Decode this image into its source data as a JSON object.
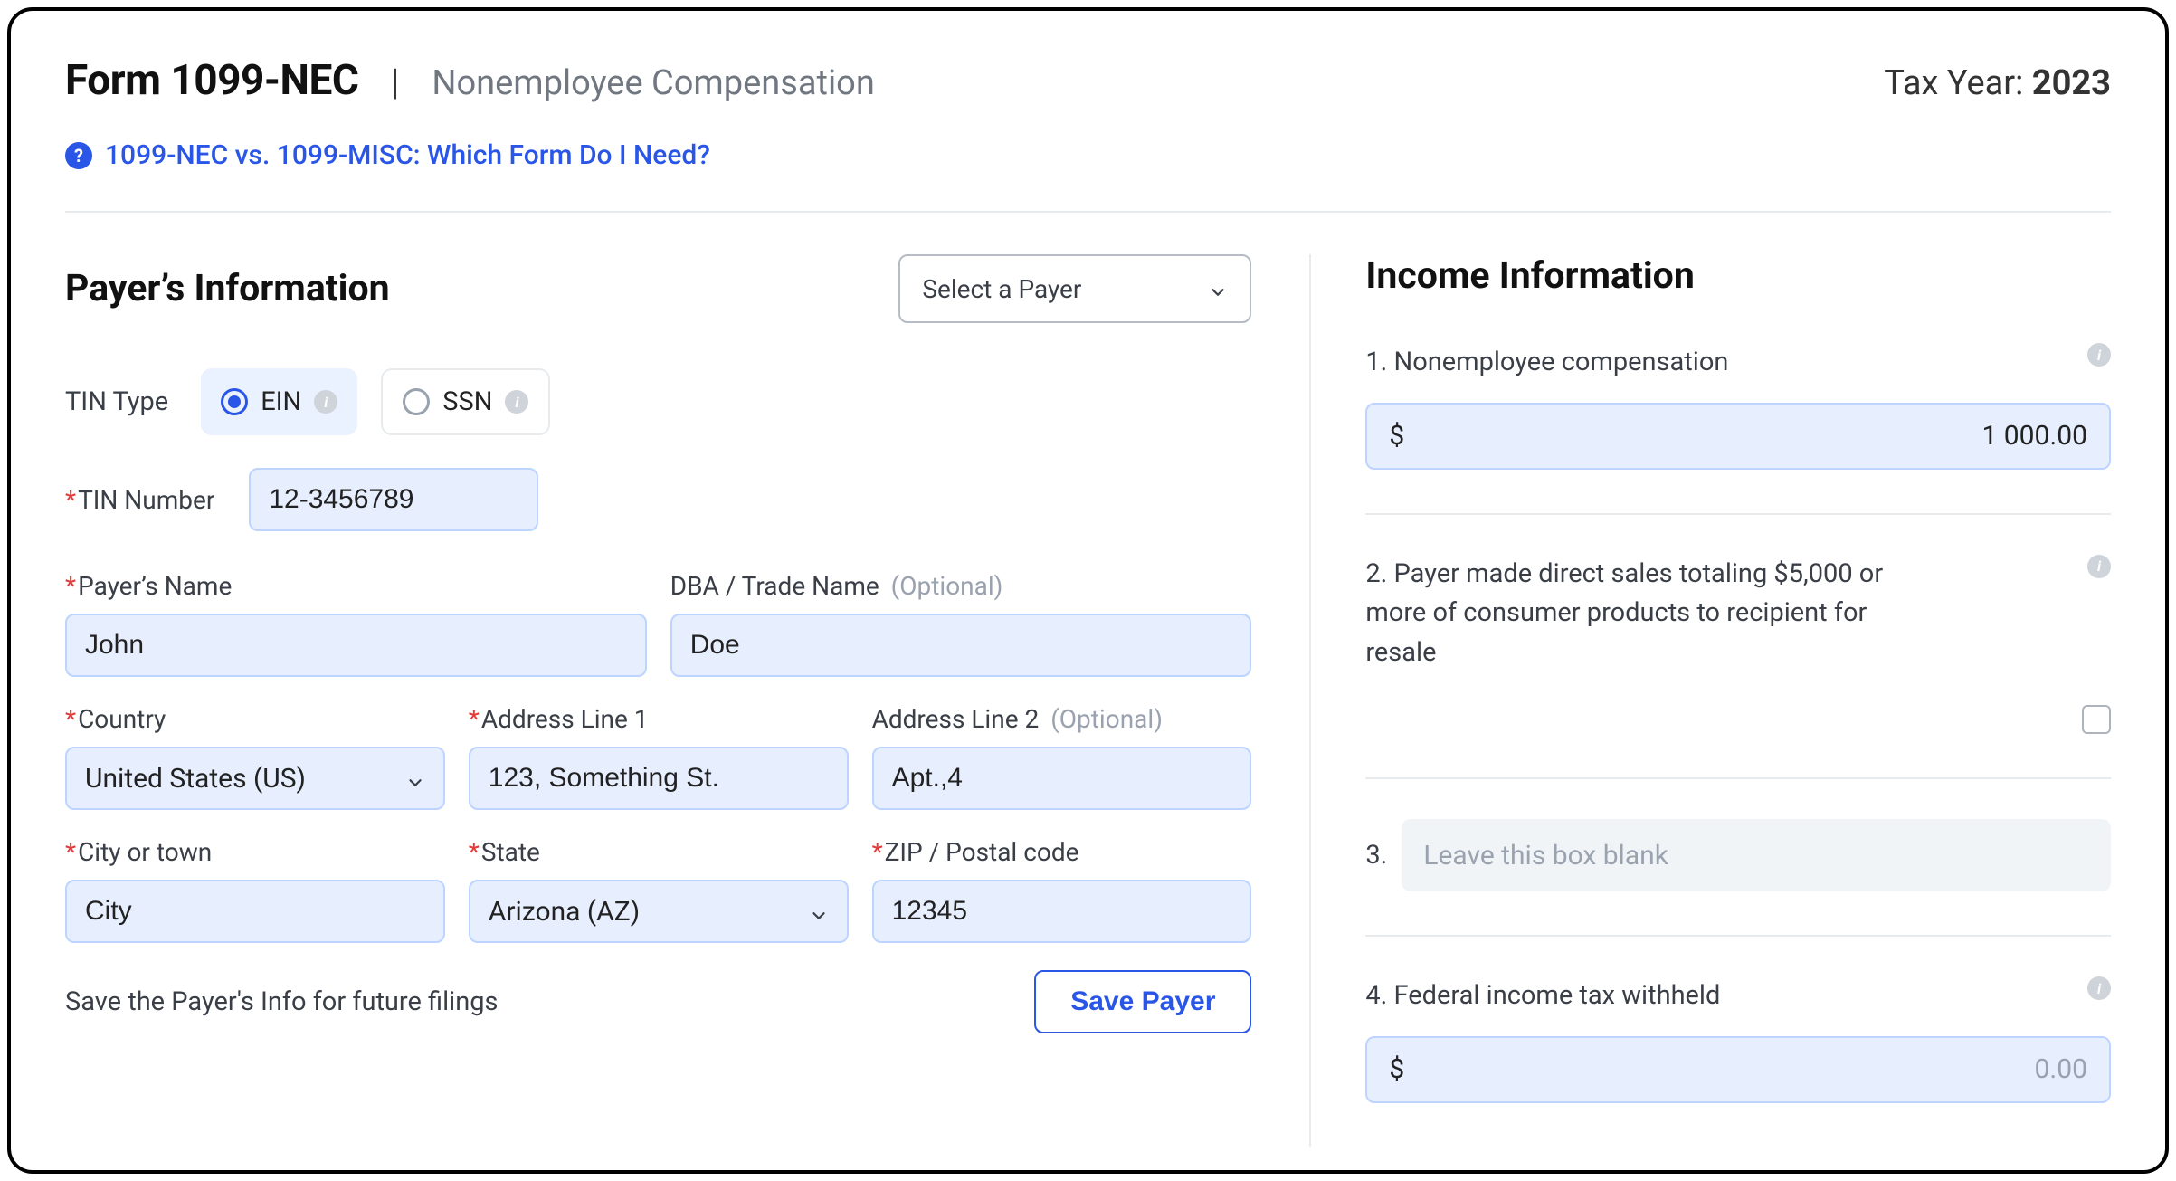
{
  "header": {
    "form_title": "Form 1099-NEC",
    "form_subtitle": "Nonemployee Compensation",
    "tax_year_label": "Tax Year:",
    "tax_year_value": "2023",
    "help_link": "1099-NEC vs. 1099-MISC: Which Form Do I Need?"
  },
  "payer": {
    "section_title": "Payer’s Information",
    "select_payer_placeholder": "Select a Payer",
    "tin_type_label": "TIN Type",
    "tin_type_ein": "EIN",
    "tin_type_ssn": "SSN",
    "tin_number_label": "TIN Number",
    "tin_number_value": "12-3456789",
    "name_label": "Payer’s Name",
    "name_value": "John",
    "dba_label": "DBA / Trade Name",
    "optional_text": "(Optional)",
    "dba_value": "Doe",
    "country_label": "Country",
    "country_value": "United States (US)",
    "addr1_label": "Address Line 1",
    "addr1_value": "123, Something St.",
    "addr2_label": "Address Line 2",
    "addr2_value": "Apt.,4",
    "city_label": "City or town",
    "city_value": "City",
    "state_label": "State",
    "state_value": "Arizona (AZ)",
    "zip_label": "ZIP / Postal code",
    "zip_value": "12345",
    "save_note": "Save the Payer's Info for future filings",
    "save_button": "Save Payer"
  },
  "income": {
    "section_title": "Income Information",
    "box1_label": "1. Nonemployee compensation",
    "box1_value": "1 000.00",
    "box2_label": "2. Payer made direct sales totaling $5,000 or more of consumer products to recipient for resale",
    "box3_num": "3.",
    "box3_placeholder": "Leave this box blank",
    "box4_label": "4. Federal income tax withheld",
    "box4_placeholder": "0.00",
    "currency": "$"
  }
}
